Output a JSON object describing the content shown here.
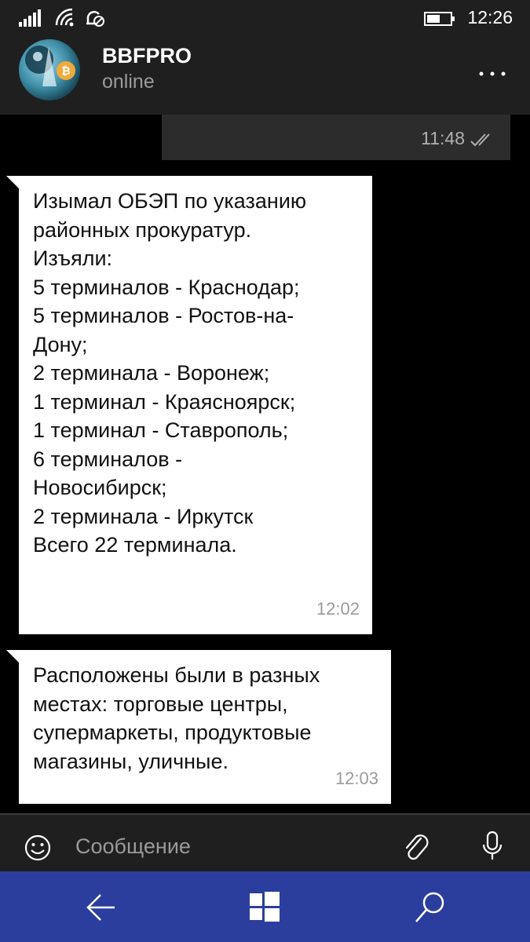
{
  "status_bar": {
    "time": "12:26",
    "icons": [
      "signal-icon",
      "wifi-icon",
      "notification-icon",
      "battery-icon"
    ]
  },
  "header": {
    "contact_name": "BBFPRO",
    "contact_status": "online",
    "avatar_icon": "bitcoin-avatar",
    "menu_icon": "more-icon"
  },
  "messages": [
    {
      "direction": "out",
      "text": "",
      "time": "11:48",
      "status_icon": "double-check-icon"
    },
    {
      "direction": "in",
      "text": "Изымал ОБЭП по указанию\nрайонных прокуратур.\nИзъяли:\n5 терминалов - Краснодар;\n5 терминалов - Ростов-на-\nДону;\n2 терминала - Воронеж;\n1 терминал - Краясноярск;\n1 терминал - Ставрополь;\n6 терминалов -\nНовосибирск;\n2 терминала - Иркутск\nВсего 22 терминала.",
      "time": "12:02"
    },
    {
      "direction": "in",
      "text": "Расположены были в разных\nместах: торговые центры,\nсупермаркеты, продуктовые\nмагазины, уличные.",
      "time": "12:03"
    }
  ],
  "input": {
    "placeholder": "Сообщение",
    "value": "",
    "icons": [
      "emoji-icon",
      "attach-icon",
      "mic-icon"
    ]
  },
  "nav_bar": {
    "icons": [
      "back-arrow-icon",
      "windows-icon",
      "search-icon"
    ]
  },
  "colors": {
    "background": "#000000",
    "bar": "#1f1f1f",
    "incoming_bubble": "#ffffff",
    "outgoing_bubble": "#2c2c2c",
    "nav_bar": "#2b3e9e"
  }
}
